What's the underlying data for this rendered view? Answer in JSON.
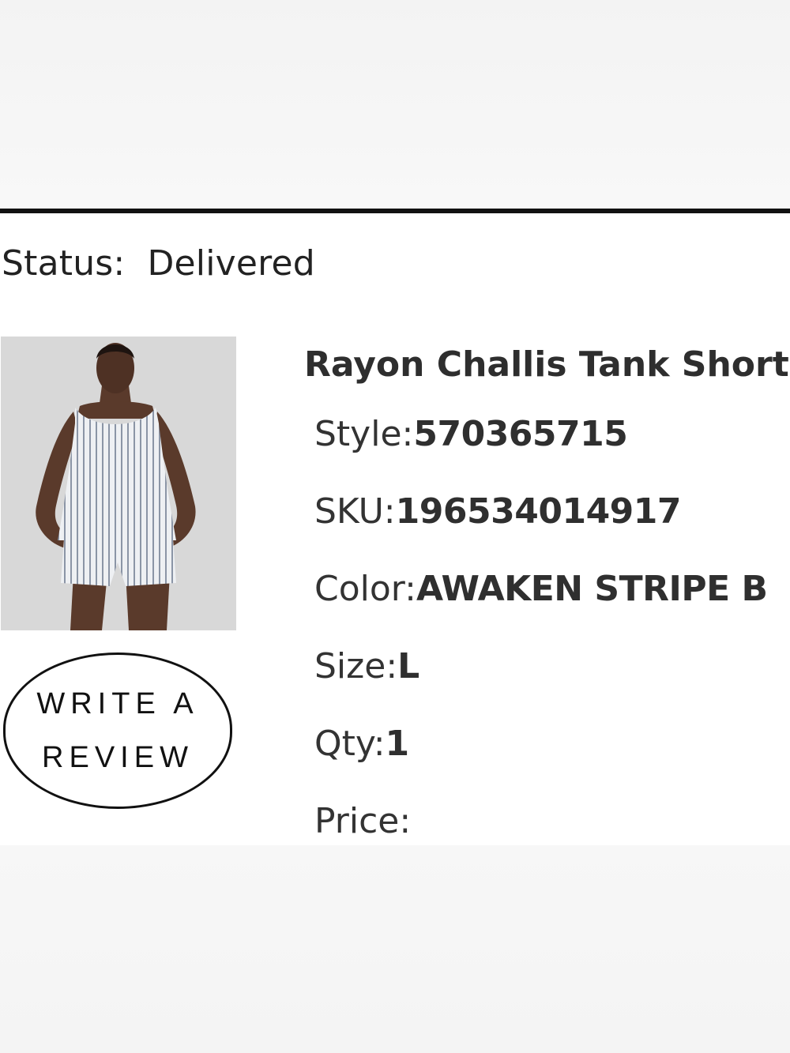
{
  "order": {
    "status_label": "Status:",
    "status_value": "Delivered"
  },
  "product": {
    "name": "Rayon Challis Tank Short",
    "image_alt": "Model wearing striped tank top and shorts",
    "details": {
      "style_label": "Style:",
      "style_value": "570365715",
      "sku_label": "SKU:",
      "sku_value": "196534014917",
      "color_label": "Color:",
      "color_value": "AWAKEN STRIPE B",
      "size_label": "Size:",
      "size_value": "L",
      "qty_label": "Qty:",
      "qty_value": "1",
      "price_label": "Price:",
      "price_value": ""
    }
  },
  "actions": {
    "write_review_label": "WRITE A REVIEW"
  },
  "colors": {
    "divider": "#111111",
    "text": "#2b2b2b",
    "image_bg": "#d9d9d9"
  }
}
